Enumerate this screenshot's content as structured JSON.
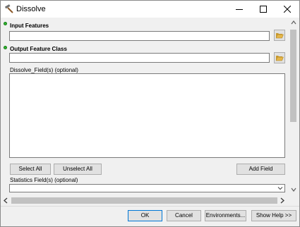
{
  "window": {
    "title": "Dissolve",
    "icons": {
      "app": "hammer-icon",
      "minimize": "minimize-icon",
      "maximize": "maximize-icon",
      "close": "close-icon"
    }
  },
  "params": {
    "input_features": {
      "label": "Input Features",
      "value": "",
      "required": true
    },
    "output_feature_class": {
      "label": "Output Feature Class",
      "value": "",
      "required": true
    },
    "dissolve_fields": {
      "label": "Dissolve_Field(s) (optional)",
      "items": []
    },
    "statistics_fields": {
      "label": "Statistics Field(s) (optional)",
      "value": ""
    }
  },
  "buttons": {
    "select_all": "Select All",
    "unselect_all": "Unselect All",
    "add_field": "Add Field",
    "ok": "OK",
    "cancel": "Cancel",
    "environments": "Environments...",
    "show_help": "Show Help >>"
  },
  "colors": {
    "required_dot": "#2fb52f",
    "focus_border": "#0078d7",
    "folder_icon": "#e5b64a"
  }
}
